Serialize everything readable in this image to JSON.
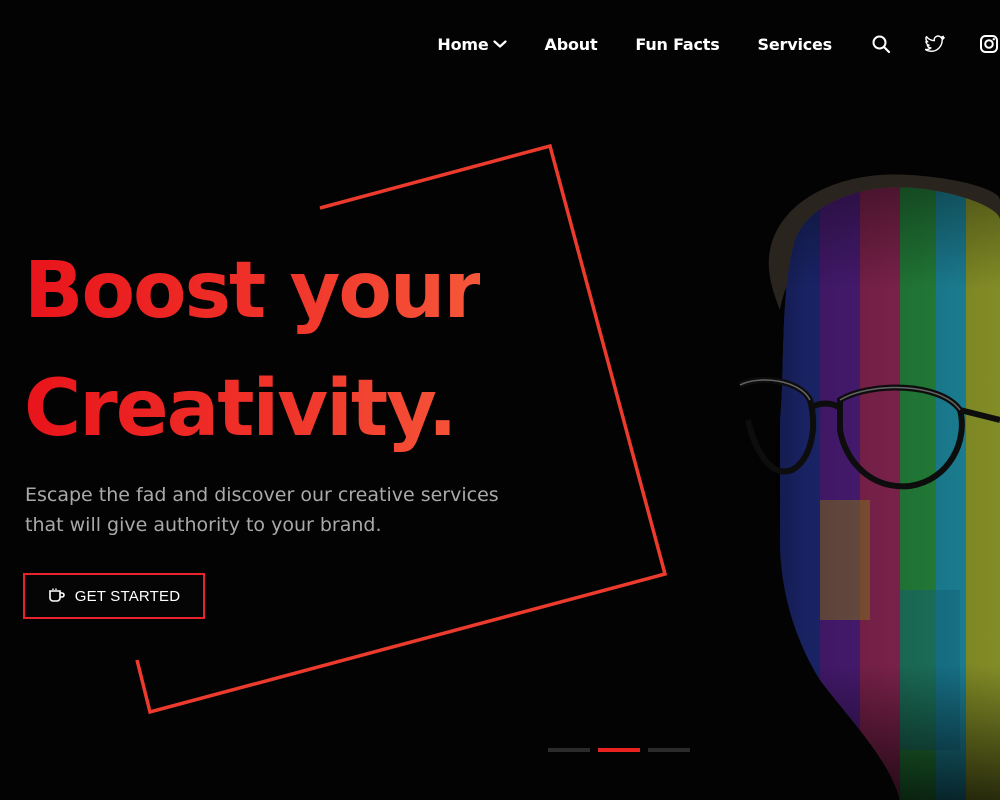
{
  "nav": {
    "home_label": "Home",
    "about_label": "About",
    "funfacts_label": "Fun Facts",
    "services_label": "Services",
    "icons": [
      "search-icon",
      "twitter-icon",
      "instagram-icon"
    ]
  },
  "hero": {
    "headline_line1": "Boost your",
    "headline_line2": "Creativity.",
    "subtitle_line1": "Escape the fad and discover our creative services",
    "subtitle_line2": "that will give authority to your brand.",
    "cta_label": "GET STARTED",
    "cta_icon": "coffee-cup-icon"
  },
  "slider": {
    "slide_count": 3,
    "active_index": 1
  },
  "colors": {
    "background": "#030303",
    "accent": "#e9232b",
    "accent_orange": "#f6573a",
    "nav_text": "#ffffff",
    "subtitle_text": "#a9a9a9"
  }
}
